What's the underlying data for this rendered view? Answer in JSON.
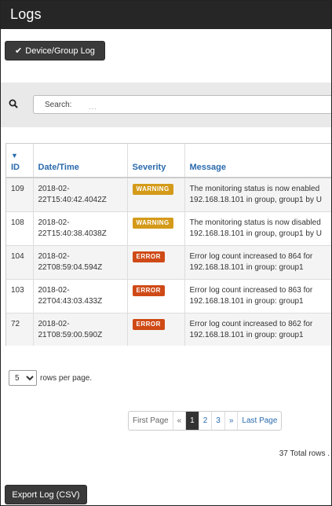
{
  "window": {
    "title": "Logs"
  },
  "toolbar": {
    "device_group_label": "Device/Group Log",
    "export_label": "Export Log (CSV)"
  },
  "search": {
    "label": "Search:",
    "dots": "..."
  },
  "table": {
    "headers": {
      "id": "ID",
      "datetime": "Date/Time",
      "severity": "Severity",
      "message": "Message"
    },
    "rows": [
      {
        "id": "109",
        "date": "2018-02-",
        "time": "22T15:40:42.4042Z",
        "severity": "WARNING",
        "msg1": "The monitoring status is now enabled",
        "msg2": "192.168.18.101 in group, group1 by U"
      },
      {
        "id": "108",
        "date": "2018-02-",
        "time": "22T15:40:38.4038Z",
        "severity": "WARNING",
        "msg1": "The monitoring status is now disabled",
        "msg2": "192.168.18.101 in group, group1 by U"
      },
      {
        "id": "104",
        "date": "2018-02-",
        "time": "22T08:59:04.594Z",
        "severity": "ERROR",
        "msg1": "Error log count increased to 864 for",
        "msg2": "192.168.18.101 in group: group1"
      },
      {
        "id": "103",
        "date": "2018-02-",
        "time": "22T04:43:03.433Z",
        "severity": "ERROR",
        "msg1": "Error log count increased to 863 for",
        "msg2": "192.168.18.101 in group: group1"
      },
      {
        "id": "72",
        "date": "2018-02-",
        "time": "21T08:59:00.590Z",
        "severity": "ERROR",
        "msg1": "Error log count increased to 862 for",
        "msg2": "192.168.18.101 in group: group1"
      }
    ]
  },
  "pagination": {
    "rows_per_page_value": "5",
    "rows_per_page_label": "rows per page.",
    "first": "First Page",
    "prev": "«",
    "pages": [
      "1",
      "2",
      "3"
    ],
    "next": "»",
    "last": "Last Page",
    "total": "37 Total rows ."
  },
  "colors": {
    "warning": "#d49a19",
    "error": "#cf4a16",
    "link": "#2a6aad",
    "titlebar": "#262626"
  }
}
